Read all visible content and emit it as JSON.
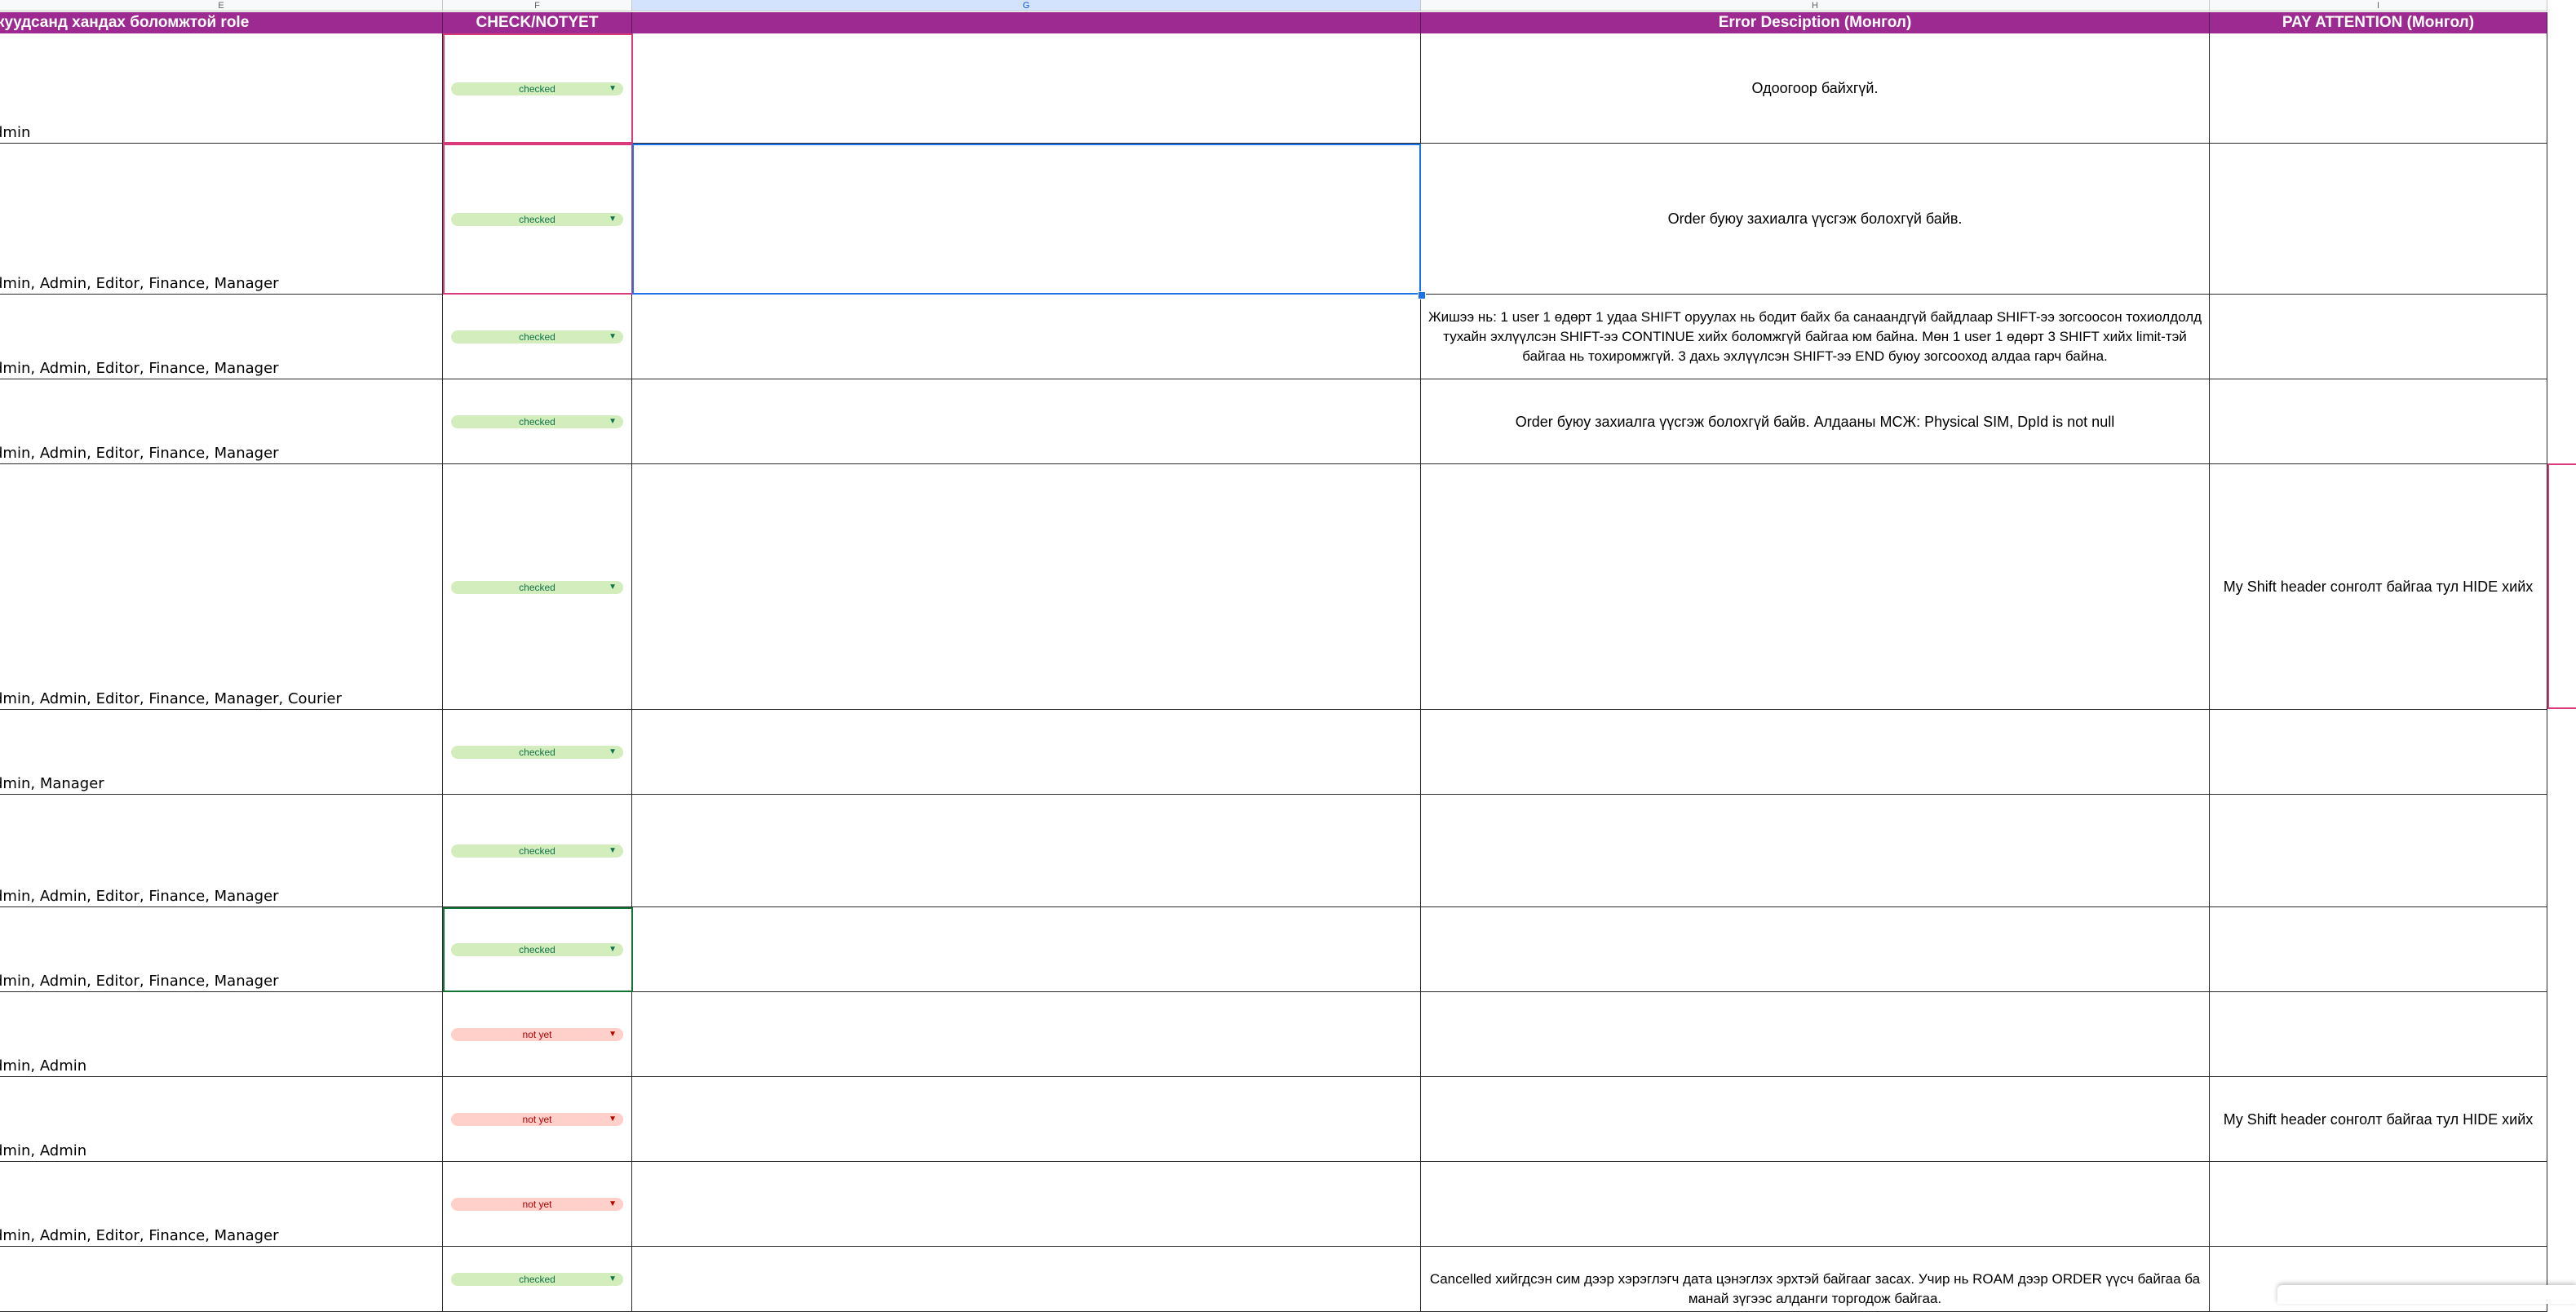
{
  "sheet": {
    "column_letters": [
      "E",
      "F",
      "G",
      "H",
      "I"
    ],
    "headers": {
      "roles": "куудсанд хандах боломжтой role",
      "check": "CHECK/NOTYET",
      "blank": "",
      "error": "Error Desciption (Монгол)",
      "pay": "PAY ATTENTION (Монгол)"
    },
    "colors": {
      "header_bg": "#9c2a91",
      "checked_chip": "#d4edbc",
      "notyet_chip": "#ffcfc9",
      "selection_blue": "#1a73e8",
      "selection_pink": "#d83a7a"
    },
    "rows": [
      {
        "roles": "dmin",
        "status": "checked",
        "error": "Одоогоор байхгүй.",
        "pay": ""
      },
      {
        "roles": "dmin, Admin, Editor, Finance, Manager",
        "status": "checked",
        "error": "Order буюу захиалга үүсгэж болохгүй байв.",
        "pay": ""
      },
      {
        "roles": "dmin, Admin, Editor, Finance, Manager",
        "status": "checked",
        "error": "Жишээ нь: 1 user 1 өдөрт 1 удаа SHIFT оруулах нь бодит байх ба санаандгүй байдлаар SHIFT-ээ зогсоосон тохиолдолд тухайн эхлүүлсэн SHIFT-ээ CONTINUE хийх боломжгүй байгаа юм байна. Мөн 1 user 1 өдөрт 3 SHIFT хийх limit-тэй байгаа нь тохиромжгүй. 3 дахь эхлүүлсэн SHIFT-ээ END буюу зогсооход алдаа гарч байна.",
        "pay": ""
      },
      {
        "roles": "dmin, Admin, Editor, Finance, Manager",
        "status": "checked",
        "error": "Order буюу захиалга үүсгэж болохгүй байв. Алдааны МСЖ: Physical SIM, DpId is not null",
        "pay": ""
      },
      {
        "roles": "dmin, Admin, Editor, Finance, Manager, Courier",
        "status": "checked",
        "error": "",
        "pay": "My Shift header сонголт байгаа тул HIDE хийх"
      },
      {
        "roles": "dmin, Manager",
        "status": "checked",
        "error": "",
        "pay": ""
      },
      {
        "roles": "dmin, Admin, Editor, Finance, Manager",
        "status": "checked",
        "error": "",
        "pay": ""
      },
      {
        "roles": "dmin, Admin, Editor, Finance, Manager",
        "status": "checked",
        "error": "",
        "pay": ""
      },
      {
        "roles": "dmin, Admin",
        "status": "not yet",
        "error": "",
        "pay": ""
      },
      {
        "roles": "dmin, Admin",
        "status": "not yet",
        "error": "",
        "pay": "My Shift header сонголт байгаа тул HIDE хийх"
      },
      {
        "roles": "dmin, Admin, Editor, Finance, Manager",
        "status": "not yet",
        "error": "",
        "pay": ""
      },
      {
        "roles": "",
        "status": "checked",
        "error": "Cancelled хийгдсэн сим дээр хэрэглэгч дата цэнэглэх эрхтэй байгааг засах. Учир нь ROAM дээр ORDER үүсч байгаа ба манай зүгээс алданги торгодож байгаа.",
        "pay": ""
      }
    ],
    "caret_glyph": "▼"
  }
}
